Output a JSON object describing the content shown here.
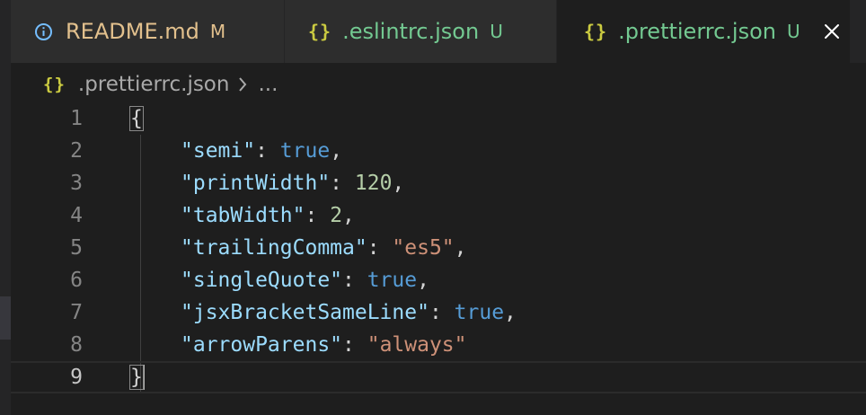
{
  "colors": {
    "editor_background": "#1e1e1e",
    "tab_background": "#252526",
    "inactive_tab": "#2d2d2d",
    "modified": "#e2c08d",
    "untracked": "#73c991",
    "json_icon": "#cbcb41",
    "json_key": "#9cdcfe",
    "json_boolean": "#569cd6",
    "json_number": "#b5cea8",
    "json_string": "#ce9178"
  },
  "tabs": [
    {
      "label": "README.md",
      "status": "M",
      "icon": "info-icon",
      "active": false
    },
    {
      "label": ".eslintrc.json",
      "status": "U",
      "icon": "json-braces-icon",
      "icon_text": "{}",
      "active": false
    },
    {
      "label": ".prettierrc.json",
      "status": "U",
      "icon": "json-braces-icon",
      "icon_text": "{}",
      "active": true,
      "close_icon": "close-icon"
    }
  ],
  "breadcrumb": {
    "icon": "json-braces-icon",
    "icon_text": "{}",
    "file": ".prettierrc.json",
    "separator_icon": "chevron-right-icon",
    "trailing": "..."
  },
  "editor": {
    "current_line": 9,
    "lines": [
      {
        "number": "1",
        "open_brace": "{"
      },
      {
        "number": "2",
        "key": "\"semi\"",
        "colon": ": ",
        "value": "true",
        "value_type": "boolean",
        "trailing": ","
      },
      {
        "number": "3",
        "key": "\"printWidth\"",
        "colon": ": ",
        "value": "120",
        "value_type": "number",
        "trailing": ","
      },
      {
        "number": "4",
        "key": "\"tabWidth\"",
        "colon": ": ",
        "value": "2",
        "value_type": "number",
        "trailing": ","
      },
      {
        "number": "5",
        "key": "\"trailingComma\"",
        "colon": ": ",
        "value": "\"es5\"",
        "value_type": "string",
        "trailing": ","
      },
      {
        "number": "6",
        "key": "\"singleQuote\"",
        "colon": ": ",
        "value": "true",
        "value_type": "boolean",
        "trailing": ","
      },
      {
        "number": "7",
        "key": "\"jsxBracketSameLine\"",
        "colon": ": ",
        "value": "true",
        "value_type": "boolean",
        "trailing": ","
      },
      {
        "number": "8",
        "key": "\"arrowParens\"",
        "colon": ": ",
        "value": "\"always\"",
        "value_type": "string",
        "trailing": ""
      },
      {
        "number": "9",
        "close_brace": "}"
      }
    ]
  }
}
